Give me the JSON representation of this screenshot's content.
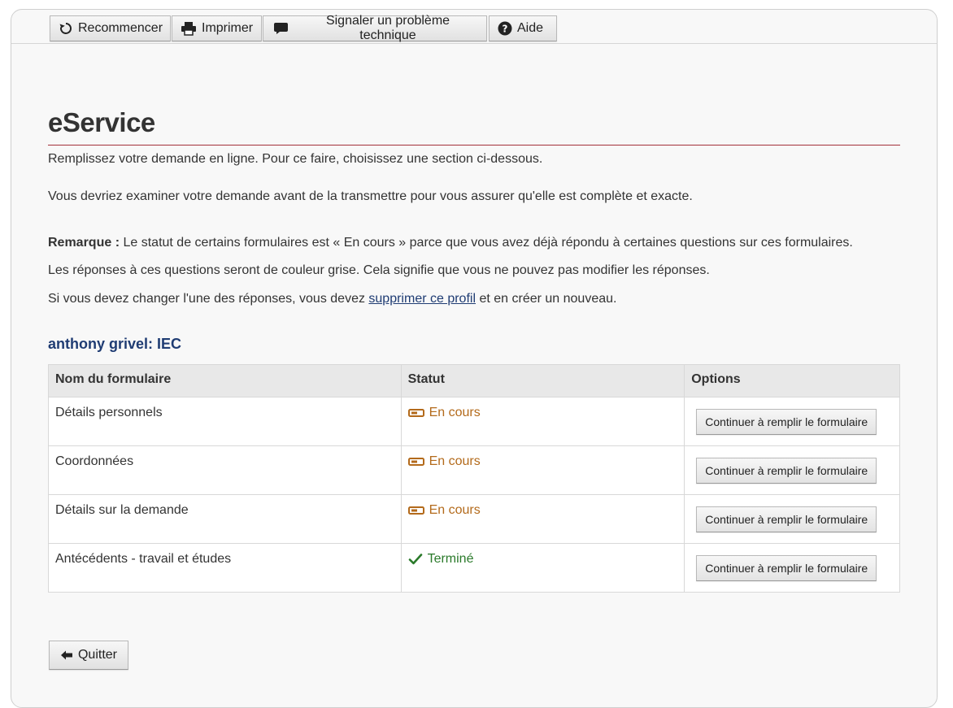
{
  "toolbar": {
    "restart_label": "Recommencer",
    "print_label": "Imprimer",
    "report_label": "Signaler un problème technique",
    "help_label": "Aide"
  },
  "page": {
    "title": "eService",
    "intro": "Remplissez votre demande en ligne. Pour ce faire, choisissez une section ci-dessous.",
    "review_note": "Vous devriez examiner votre demande avant de la transmettre pour vous assurer qu'elle est complète et exacte.",
    "remark_label": "Remarque :",
    "remark_text": " Le statut de certains formulaires est « En cours » parce que vous avez déjà répondu à certaines questions sur ces formulaires.",
    "grey_answers_note": "Les réponses à ces questions seront de couleur grise. Cela signifie que vous ne pouvez pas modifier les réponses.",
    "change_note_before": "Si vous devez changer l'une des réponses, vous devez ",
    "delete_profile_link": "supprimer ce profil",
    "change_note_after": " et en créer un nouveau."
  },
  "profile": {
    "name": "anthony grivel: IEC"
  },
  "table": {
    "headers": {
      "form": "Nom du formulaire",
      "status": "Statut",
      "options": "Options"
    },
    "rows": [
      {
        "form": "Détails personnels",
        "status": "En cours",
        "action": "Continuer à remplir le formulaire"
      },
      {
        "form": "Coordonnées",
        "status": "En cours",
        "action": "Continuer à remplir le formulaire"
      },
      {
        "form": "Détails sur la demande",
        "status": "En cours",
        "action": "Continuer à remplir le formulaire"
      },
      {
        "form": "Antécédents - travail et études",
        "status": "Terminé",
        "action": "Continuer à remplir le formulaire"
      }
    ]
  },
  "footer": {
    "quit_label": "Quitter"
  },
  "icons": {
    "restart": "restart-icon",
    "print": "printer-icon",
    "report": "speech-bubble-icon",
    "help": "question-circle-icon",
    "in_progress": "progress-bar-icon",
    "done": "checkmark-icon",
    "quit": "arrow-left-icon"
  },
  "colors": {
    "accent_rule": "#a3313a",
    "link": "#1f3c73",
    "in_progress": "#b36a1b",
    "done": "#2a7a2a"
  }
}
